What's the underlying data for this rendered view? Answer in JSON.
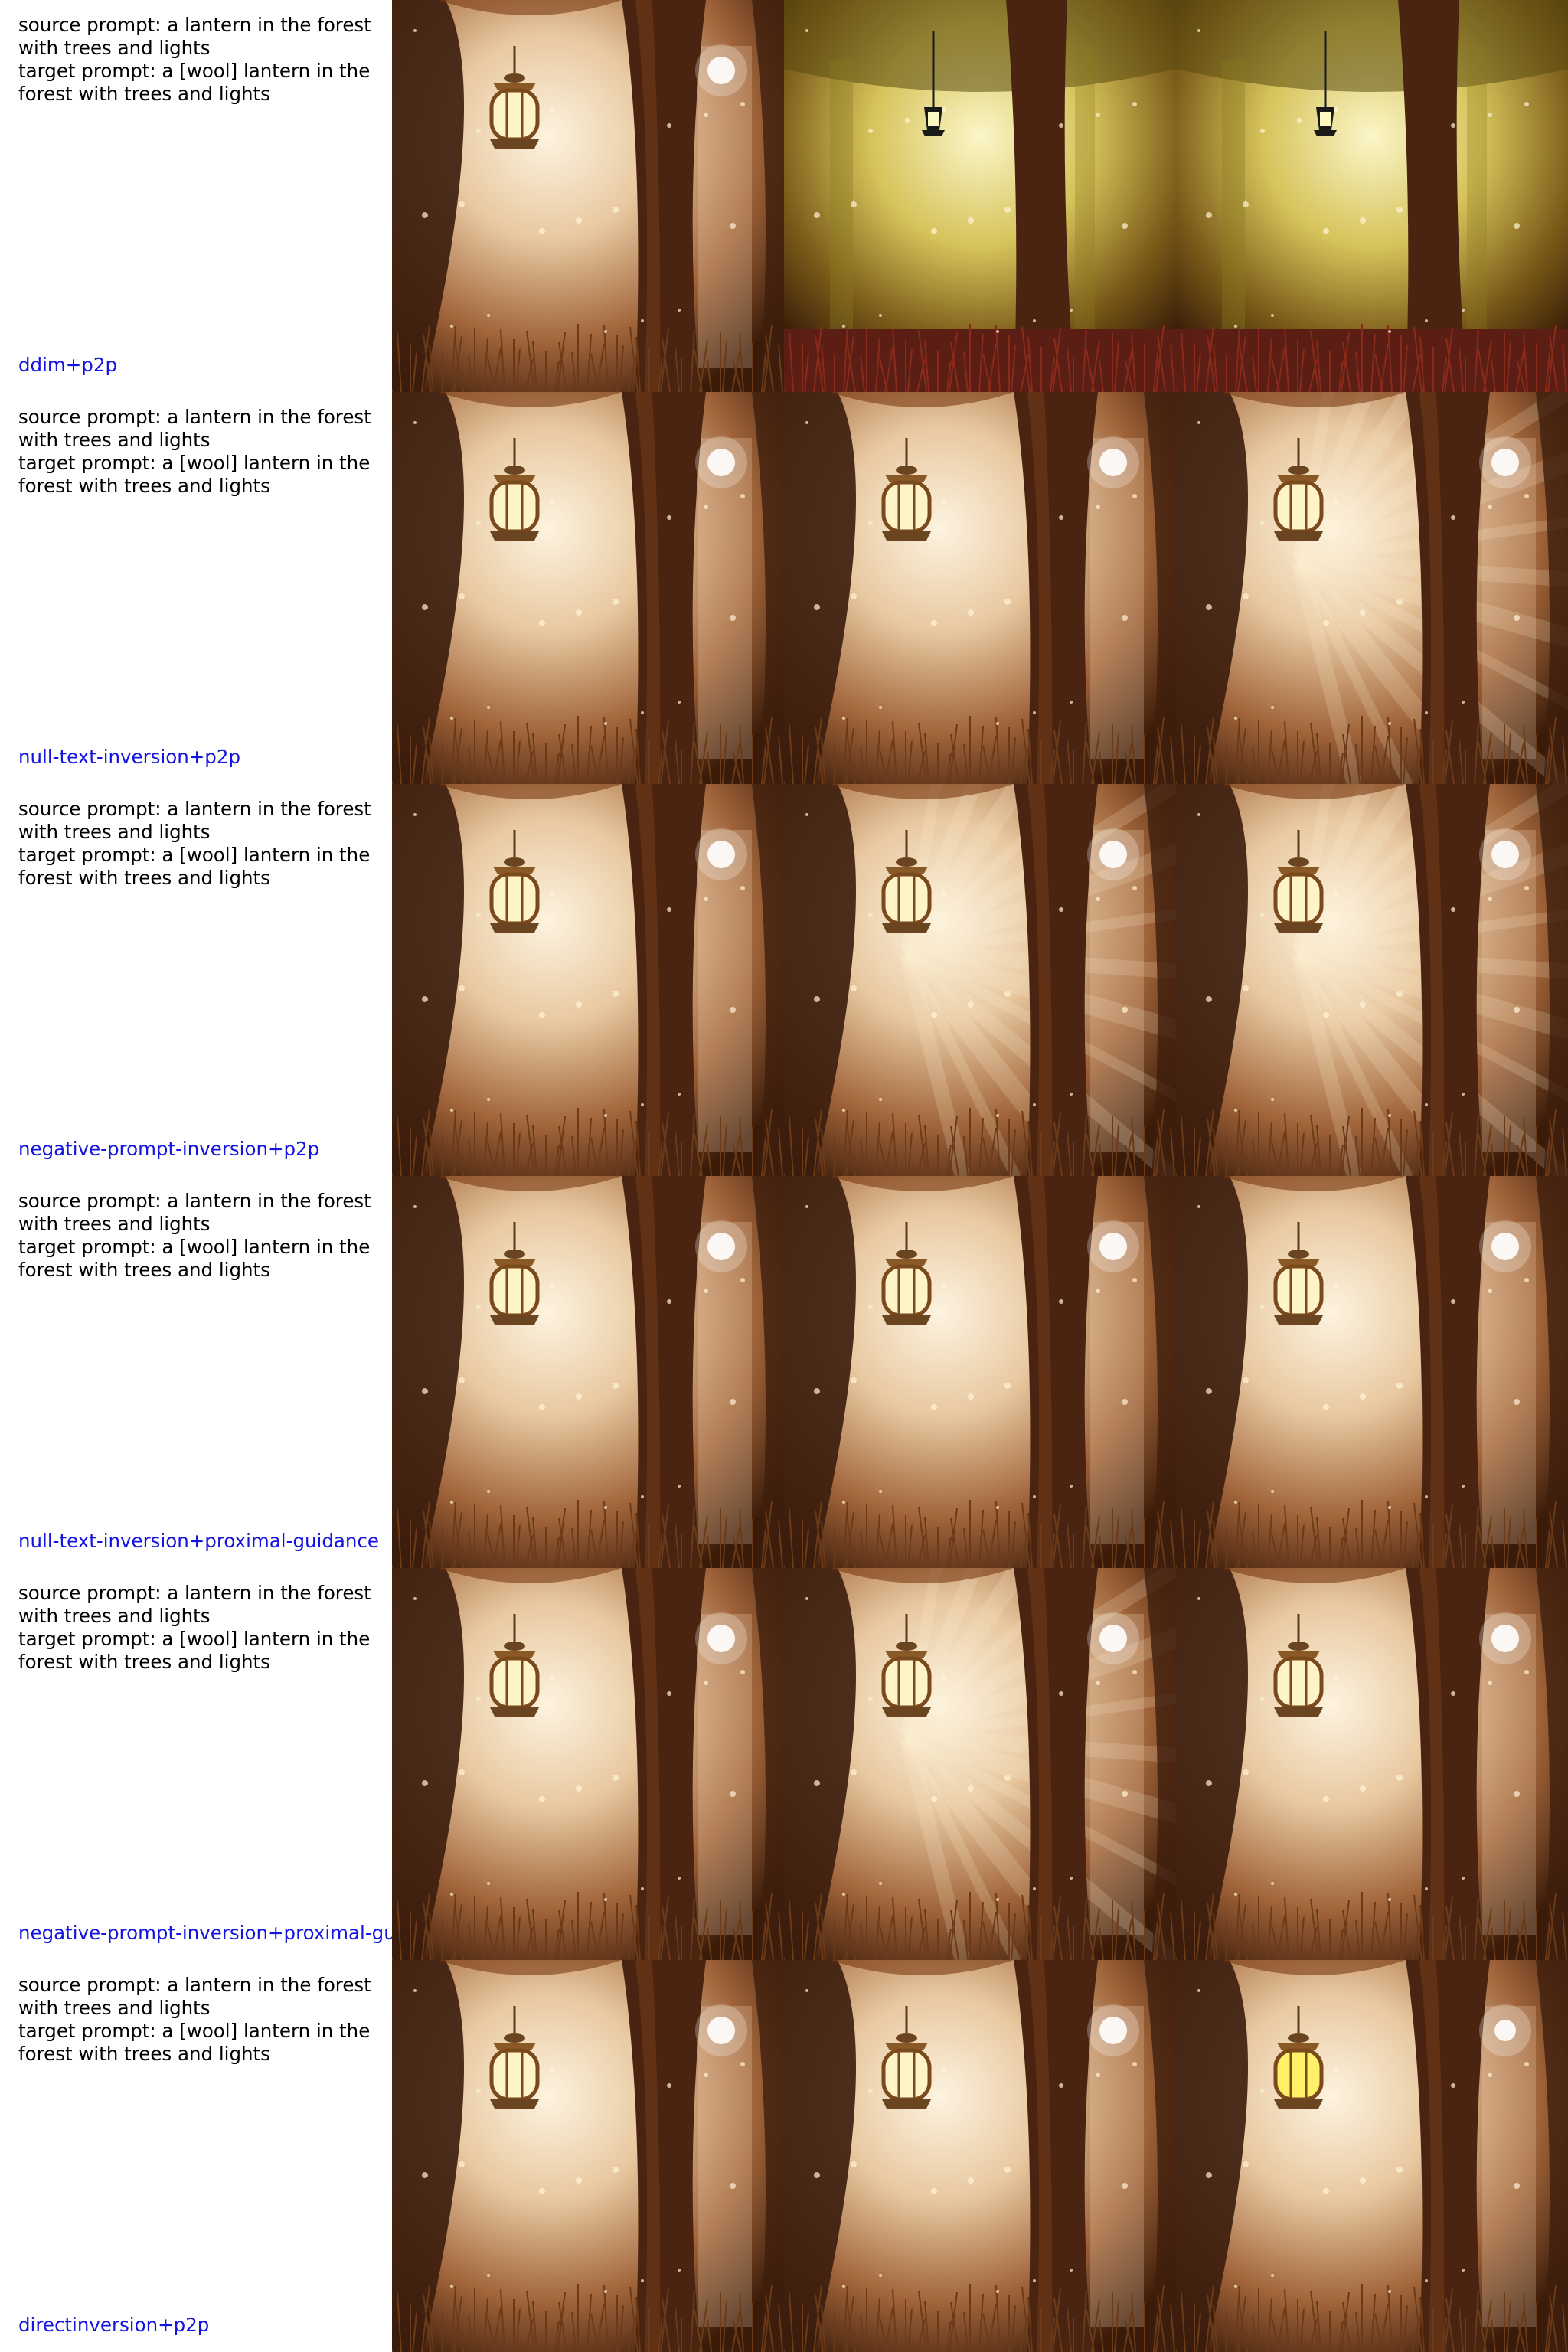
{
  "colors": {
    "method_label": "#1414e0",
    "text": "#000000",
    "background": "#ffffff"
  },
  "rows": [
    {
      "source_prompt": "source prompt: a lantern in the forest with trees and lights",
      "target_prompt": "target prompt: a [wool] lantern in the forest with trees and lights",
      "method": "ddim+p2p",
      "panels": [
        "warm",
        "yellow-sign",
        "yellow-sign"
      ]
    },
    {
      "source_prompt": "source prompt: a lantern in the forest with trees and lights",
      "target_prompt": "target prompt: a [wool] lantern in the forest with trees and lights",
      "method": "null-text-inversion+p2p",
      "panels": [
        "warm",
        "warm",
        "rays"
      ]
    },
    {
      "source_prompt": "source prompt: a lantern in the forest with trees and lights",
      "target_prompt": "target prompt: a [wool] lantern in the forest with trees and lights",
      "method": "negative-prompt-inversion+p2p",
      "panels": [
        "warm",
        "rays",
        "rays"
      ]
    },
    {
      "source_prompt": "source prompt: a lantern in the forest with trees and lights",
      "target_prompt": "target prompt: a [wool] lantern in the forest with trees and lights",
      "method": "null-text-inversion+proximal-guidance",
      "panels": [
        "warm",
        "warm",
        "warm"
      ]
    },
    {
      "source_prompt": "source prompt: a lantern in the forest with trees and lights",
      "target_prompt": "target prompt: a [wool] lantern in the forest with trees and lights",
      "method": "negative-prompt-inversion+proximal-guidance",
      "panels": [
        "warm",
        "rays",
        "warm"
      ]
    },
    {
      "source_prompt": "source prompt: a lantern in the forest with trees and lights",
      "target_prompt": "target prompt: a [wool] lantern in the forest with trees and lights",
      "method": "directinversion+p2p",
      "panels": [
        "warm",
        "warm",
        "bright"
      ]
    }
  ]
}
